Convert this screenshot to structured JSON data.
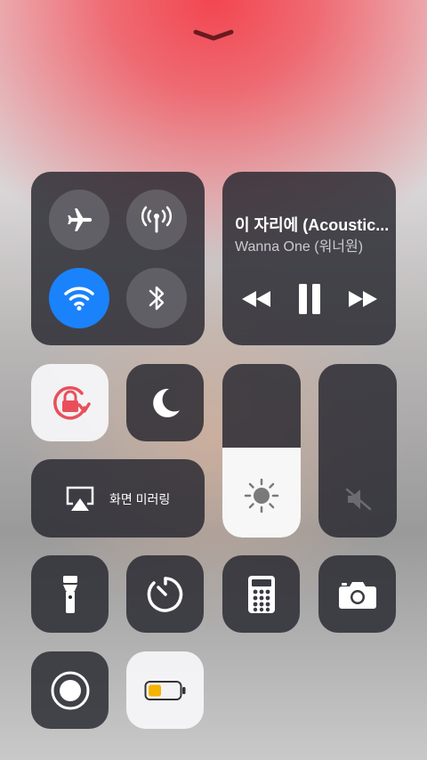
{
  "header": {
    "dismiss_icon": "chevron-down-icon"
  },
  "connectivity": {
    "airplane": {
      "icon": "airplane-icon",
      "on": false
    },
    "cellular": {
      "icon": "cellular-antenna-icon",
      "on": false
    },
    "wifi": {
      "icon": "wifi-icon",
      "on": true,
      "color": "#1a82fb"
    },
    "bluetooth": {
      "icon": "bluetooth-icon",
      "on": false
    }
  },
  "music": {
    "title": "이 자리에 (Acoustic...",
    "artist": "Wanna One (워너원)",
    "controls": [
      "rewind-icon",
      "pause-icon",
      "fast-forward-icon"
    ]
  },
  "toggles": {
    "rotation_lock": {
      "icon": "rotation-lock-icon",
      "on": true,
      "color": "#e94f5b"
    },
    "do_not_disturb": {
      "icon": "moon-icon",
      "on": false
    }
  },
  "screen_mirroring": {
    "label": "화면 미러링",
    "icon": "airplay-icon"
  },
  "brightness": {
    "icon": "sun-icon",
    "level": 0.52
  },
  "volume": {
    "icon": "speaker-muted-icon",
    "level": 0.0
  },
  "shortcuts": [
    {
      "icon": "flashlight-icon"
    },
    {
      "icon": "timer-icon"
    },
    {
      "icon": "calculator-icon"
    },
    {
      "icon": "camera-icon"
    },
    {
      "icon": "screen-record-icon"
    },
    {
      "icon": "low-power-battery-icon",
      "color": "#f4b400"
    }
  ]
}
